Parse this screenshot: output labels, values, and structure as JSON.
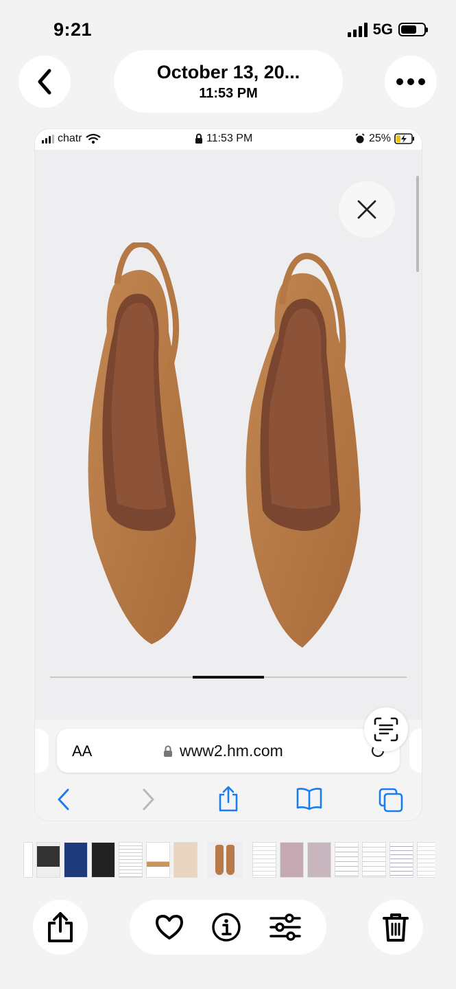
{
  "status_bar": {
    "time": "9:21",
    "network": "5G"
  },
  "nav": {
    "date": "October 13, 20...",
    "time": "11:53 PM"
  },
  "inner_status": {
    "carrier": "chatr",
    "time": "11:53 PM",
    "battery": "25%"
  },
  "browser": {
    "aa_label": "AA",
    "url": "www2.hm.com"
  },
  "product_image": {
    "pager_index": 3,
    "pager_total": 5
  },
  "thumbnails": {
    "count_before": 7,
    "count_after": 8
  },
  "colors": {
    "background": "#f3f3f3",
    "shoe": "#b87a46",
    "accent_blue": "#1a7cf2"
  }
}
